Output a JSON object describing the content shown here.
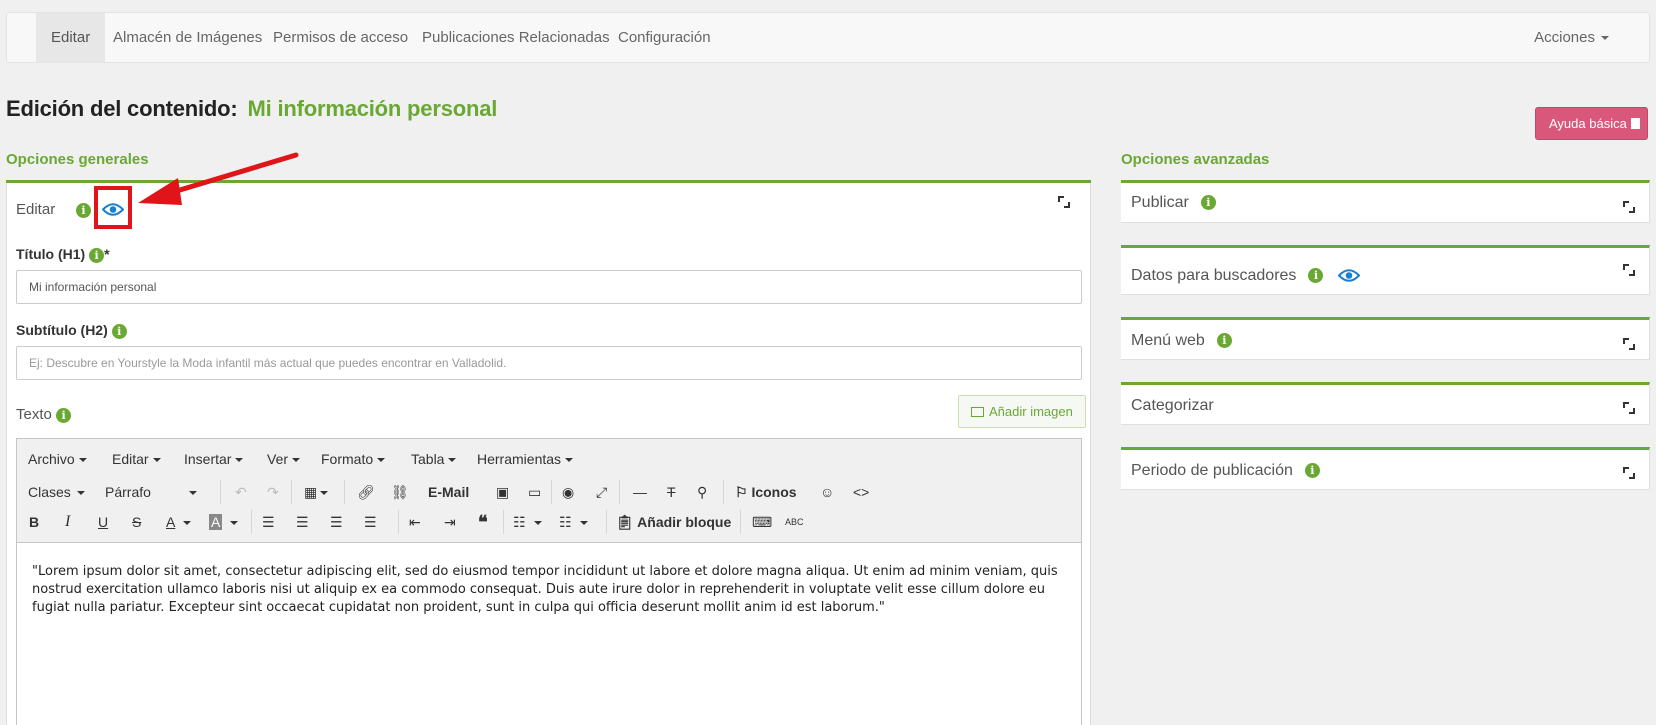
{
  "nav": {
    "tabs": [
      "Editar",
      "Almacén de Imágenes",
      "Permisos de acceso",
      "Publicaciones Relacionadas",
      "Configuración"
    ],
    "actions_label": "Acciones"
  },
  "title": {
    "prefix": "Edición del contenido:",
    "name": "Mi información personal"
  },
  "help_button": "Ayuda básica",
  "general": {
    "heading": "Opciones generales",
    "edit_label": "Editar",
    "title_label": "Título (H1)",
    "required_mark": "*",
    "title_value": "Mi información personal",
    "subtitle_label": "Subtítulo (H2)",
    "subtitle_placeholder": "Ej: Descubre en Yourstyle la Moda infantil más actual que puedes encontrar en Valladolid.",
    "text_label": "Texto",
    "add_image": "Añadir imagen"
  },
  "editor": {
    "menus": [
      "Archivo",
      "Editar",
      "Insertar",
      "Ver",
      "Formato",
      "Tabla",
      "Herramientas"
    ],
    "classes": "Clases",
    "paragraph": "Párrafo",
    "email": "E-Mail",
    "icons": "Iconos",
    "add_block": "Añadir bloque",
    "content": "\"Lorem ipsum dolor sit amet, consectetur adipiscing elit, sed do eiusmod tempor incididunt ut labore et dolore magna aliqua. Ut enim ad minim veniam, quis nostrud exercitation ullamco laboris nisi ut aliquip ex ea commodo consequat. Duis aute irure dolor in reprehenderit in voluptate velit esse cillum dolore eu fugiat nulla pariatur. Excepteur sint occaecat cupidatat non proident, sunt in culpa qui officia deserunt mollit anim id est laborum.\""
  },
  "advanced": {
    "heading": "Opciones avanzadas",
    "panels": [
      "Publicar",
      "Datos para buscadores",
      "Menú web",
      "Categorizar",
      "Periodo de publicación"
    ]
  },
  "colors": {
    "green": "#6aa834",
    "pink": "#d9577a",
    "red": "#e0151a",
    "blue": "#1a7fd0"
  }
}
